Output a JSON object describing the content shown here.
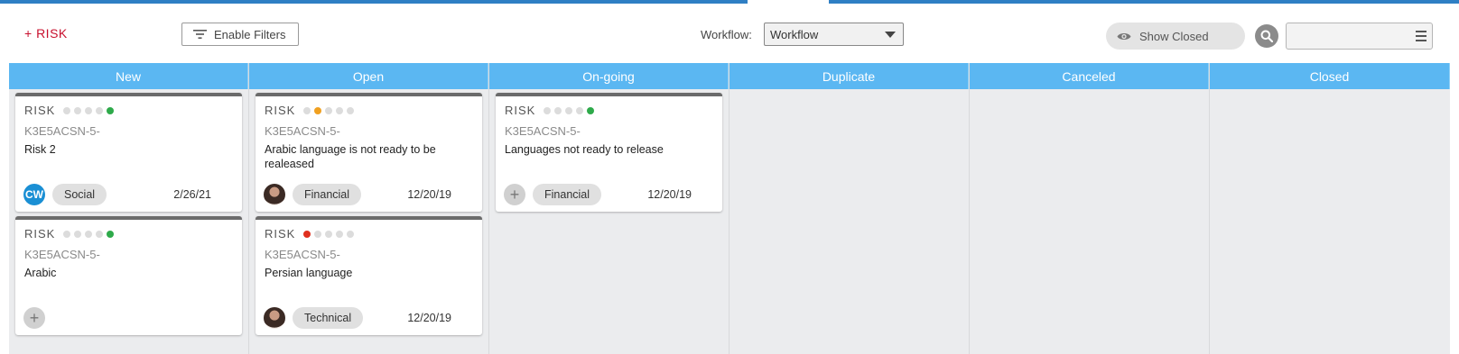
{
  "toolbar": {
    "add_label": "+ RISK",
    "filters_label": "Enable Filters",
    "workflow_label": "Workflow:",
    "workflow_value": "Workflow",
    "show_closed_label": "Show Closed",
    "search_value": ""
  },
  "columns": [
    {
      "title": "New"
    },
    {
      "title": "Open"
    },
    {
      "title": "On-going"
    },
    {
      "title": "Duplicate"
    },
    {
      "title": "Canceled"
    },
    {
      "title": "Closed"
    }
  ],
  "cards": [
    {
      "type": "RISK",
      "id": "K3E5ACSN-5-",
      "title": "Risk 2",
      "assignee": "CW",
      "category": "Social",
      "date": "2/26/21",
      "status_dot_index": 4,
      "status_color": "#2eaa4a"
    },
    {
      "type": "RISK",
      "id": "K3E5ACSN-5-",
      "title": "Arabic",
      "assignee": "",
      "category": "",
      "date": "",
      "status_dot_index": 4,
      "status_color": "#2eaa4a"
    },
    {
      "type": "RISK",
      "id": "K3E5ACSN-5-",
      "title": "Arabic language is not ready to be realeased",
      "assignee": "photo",
      "category": "Financial",
      "date": "12/20/19",
      "status_dot_index": 1,
      "status_color": "#f0a020"
    },
    {
      "type": "RISK",
      "id": "K3E5ACSN-5-",
      "title": "Persian language",
      "assignee": "photo",
      "category": "Technical",
      "date": "12/20/19",
      "status_dot_index": 0,
      "status_color": "#e0301e"
    },
    {
      "type": "RISK",
      "id": "K3E5ACSN-5-",
      "title": "Languages not ready to release",
      "assignee": "",
      "category": "Financial",
      "date": "12/20/19",
      "status_dot_index": 4,
      "status_color": "#2eaa4a"
    }
  ],
  "colors": {
    "header_blue": "#5bb7f2",
    "accent_red": "#c8102e",
    "column_bg": "#ebecee"
  }
}
